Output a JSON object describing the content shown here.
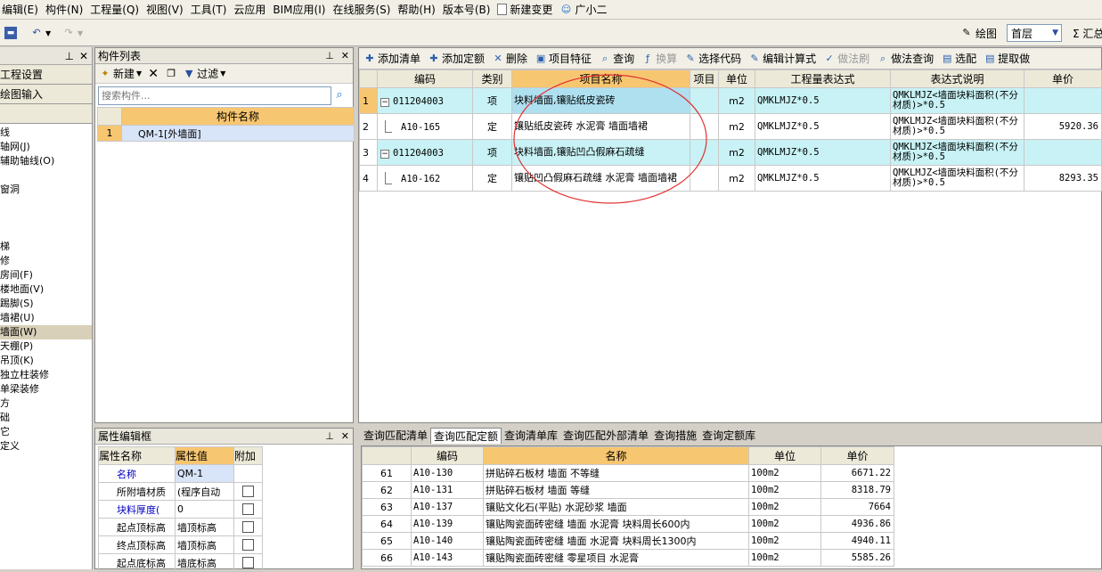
{
  "menu": [
    "编辑(E)",
    "构件(N)",
    "工程量(Q)",
    "视图(V)",
    "工具(T)",
    "云应用",
    "BIM应用(I)",
    "在线服务(S)",
    "帮助(H)",
    "版本号(B)",
    "新建变更",
    "广小二"
  ],
  "toolbar": {
    "draw_label": "绘图",
    "floor_value": "首层",
    "sum_label": "Σ 汇总"
  },
  "leftnav": {
    "buttons": [
      "工程设置",
      "绘图输入"
    ],
    "items": [
      "线",
      "轴网(J)",
      "辅助轴线(O)",
      "",
      "窗洞",
      "",
      "",
      "",
      "梯",
      "修",
      "房间(F)",
      "楼地面(V)",
      "踢脚(S)",
      "墙裙(U)",
      "墙面(W)",
      "天棚(P)",
      "吊顶(K)",
      "独立柱装修",
      "单梁装修",
      "方",
      "础",
      "它",
      "定义"
    ],
    "selected_index": 14
  },
  "component_list": {
    "title": "构件列表",
    "new_label": "新建",
    "filter_label": "过滤",
    "search_placeholder": "搜索构件...",
    "col_header": "构件名称",
    "rows": [
      {
        "no": "1",
        "name": "QM-1[外墙面]"
      }
    ]
  },
  "properties": {
    "title": "属性编辑框",
    "headers": [
      "属性名称",
      "属性值",
      "附加"
    ],
    "rows": [
      {
        "name": "名称",
        "value": "QM-1",
        "blue": true,
        "check": false
      },
      {
        "name": "所附墙材质",
        "value": "(程序自动",
        "blue": false,
        "check": true
      },
      {
        "name": "块料厚度(",
        "value": "0",
        "blue": true,
        "check": true
      },
      {
        "name": "起点顶标高",
        "value": "墙顶标高",
        "blue": false,
        "check": true
      },
      {
        "name": "终点顶标高",
        "value": "墙顶标高",
        "blue": false,
        "check": true
      },
      {
        "name": "起点底标高",
        "value": "墙底标高",
        "blue": false,
        "check": true
      }
    ]
  },
  "quota_toolbar": [
    "添加清单",
    "添加定额",
    "删除",
    "项目特征",
    "查询",
    "换算",
    "选择代码",
    "编辑计算式",
    "做法刷",
    "做法查询",
    "选配",
    "提取做"
  ],
  "quota_table": {
    "headers": [
      "编码",
      "类别",
      "项目名称",
      "项目",
      "单位",
      "工程量表达式",
      "表达式说明",
      "单价"
    ],
    "rows": [
      {
        "no": "1",
        "code": "011204003",
        "type": "项",
        "name": "块料墙面,镶贴纸皮瓷砖",
        "unit": "m2",
        "expr": "QMKLMJZ*0.5",
        "desc": "QMKLMJZ<墙面块料面积(不分材质)>*0.5",
        "price": "",
        "tree": "minus",
        "highlight": true
      },
      {
        "no": "2",
        "code": "A10-165",
        "type": "定",
        "name": "镶贴纸皮瓷砖 水泥膏 墙面墙裙",
        "unit": "m2",
        "expr": "QMKLMJZ*0.5",
        "desc": "QMKLMJZ<墙面块料面积(不分材质)>*0.5",
        "price": "5920.36",
        "tree": "line",
        "highlight": false
      },
      {
        "no": "3",
        "code": "011204003",
        "type": "项",
        "name": "块料墙面,镶贴凹凸假麻石疏缝",
        "unit": "m2",
        "expr": "QMKLMJZ*0.5",
        "desc": "QMKLMJZ<墙面块料面积(不分材质)>*0.5",
        "price": "",
        "tree": "minus",
        "highlight": true
      },
      {
        "no": "4",
        "code": "A10-162",
        "type": "定",
        "name": "镶贴凹凸假麻石疏缝 水泥膏 墙面墙裙",
        "unit": "m2",
        "expr": "QMKLMJZ*0.5",
        "desc": "QMKLMJZ<墙面块料面积(不分材质)>*0.5",
        "price": "8293.35",
        "tree": "line",
        "highlight": false
      }
    ]
  },
  "query_tabs": [
    "查询匹配清单",
    "查询匹配定额",
    "查询清单库",
    "查询匹配外部清单",
    "查询措施",
    "查询定额库"
  ],
  "query_active": 1,
  "query_table": {
    "headers": [
      "编码",
      "名称",
      "单位",
      "单价"
    ],
    "rows": [
      {
        "no": "61",
        "code": "A10-130",
        "name": "拼贴碎石板材 墙面 不等缝",
        "unit": "100m2",
        "price": "6671.22"
      },
      {
        "no": "62",
        "code": "A10-131",
        "name": "拼贴碎石板材 墙面 等缝",
        "unit": "100m2",
        "price": "8318.79"
      },
      {
        "no": "63",
        "code": "A10-137",
        "name": "镶贴文化石(平贴) 水泥砂浆 墙面",
        "unit": "100m2",
        "price": "7664"
      },
      {
        "no": "64",
        "code": "A10-139",
        "name": "镶贴陶瓷面砖密缝 墙面 水泥膏 块料周长600内",
        "unit": "100m2",
        "price": "4936.86"
      },
      {
        "no": "65",
        "code": "A10-140",
        "name": "镶贴陶瓷面砖密缝 墙面 水泥膏 块料周长1300内",
        "unit": "100m2",
        "price": "4940.11"
      },
      {
        "no": "66",
        "code": "A10-143",
        "name": "镶贴陶瓷面砖密缝 零星项目 水泥膏",
        "unit": "100m2",
        "price": "5585.26"
      }
    ]
  }
}
